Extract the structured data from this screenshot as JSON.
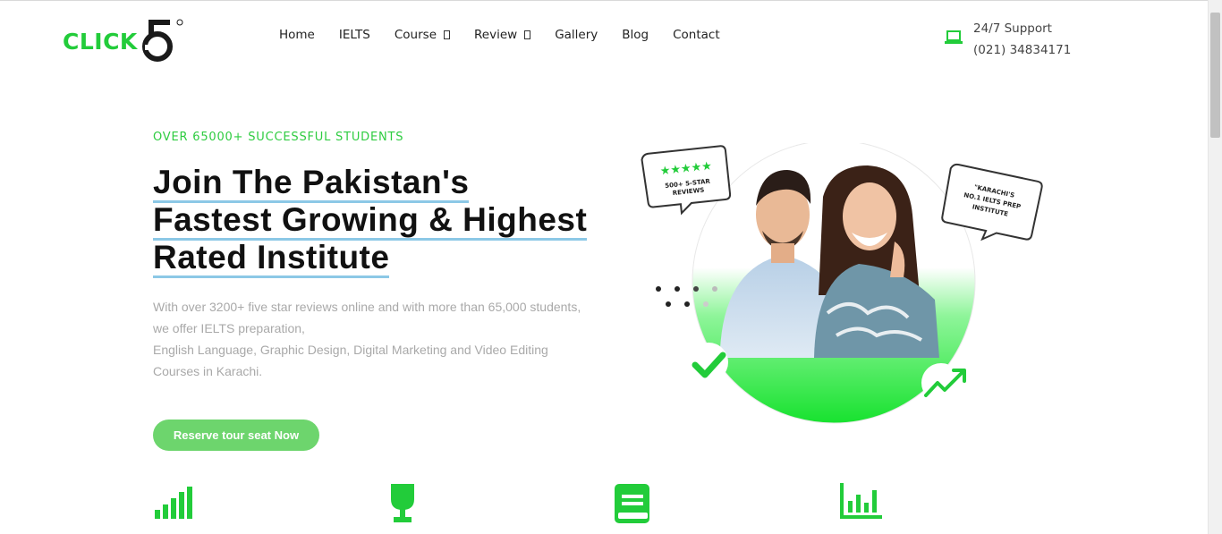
{
  "header": {
    "logo_text": "CLICK",
    "logo_mark": "5",
    "nav": [
      {
        "label": "Home",
        "has_dropdown": false
      },
      {
        "label": "IELTS",
        "has_dropdown": false
      },
      {
        "label": "Course",
        "has_dropdown": true
      },
      {
        "label": "Review",
        "has_dropdown": true
      },
      {
        "label": "Gallery",
        "has_dropdown": false
      },
      {
        "label": "Blog",
        "has_dropdown": false
      },
      {
        "label": "Contact",
        "has_dropdown": false
      }
    ],
    "support": {
      "icon": "laptop-icon",
      "title": "24/7 Support",
      "phone": "(021) 34834171"
    }
  },
  "hero": {
    "eyebrow": "OVER 65000+ SUCCESSFUL STUDENTS",
    "headline_lines": [
      "Join The Pakistan's",
      "Fastest Growing & Highest",
      "Rated Institute"
    ],
    "description_lines": [
      "With over 3200+ five star reviews online and with more than 65,000 students,",
      "we offer IELTS preparation,",
      "English Language, Graphic Design, Digital Marketing and Video Editing",
      "Courses in Karachi."
    ],
    "cta_label": "Reserve tour seat Now",
    "image": {
      "bubble_left_line1": "500+ 5-STAR",
      "bubble_left_line2": "REVIEWS",
      "bubble_right_line1": "\"KARACHI'S",
      "bubble_right_line2": "NO.1 IELTS PREP",
      "bubble_right_line3": "INSTITUTE"
    }
  },
  "features": [
    {
      "icon": "signal-bars-icon"
    },
    {
      "icon": "trophy-icon"
    },
    {
      "icon": "book-icon"
    },
    {
      "icon": "bar-chart-icon"
    }
  ],
  "colors": {
    "brand_green": "#22cc3a",
    "cta_green": "#6dd56d",
    "underline_blue": "#8cc8e6"
  }
}
